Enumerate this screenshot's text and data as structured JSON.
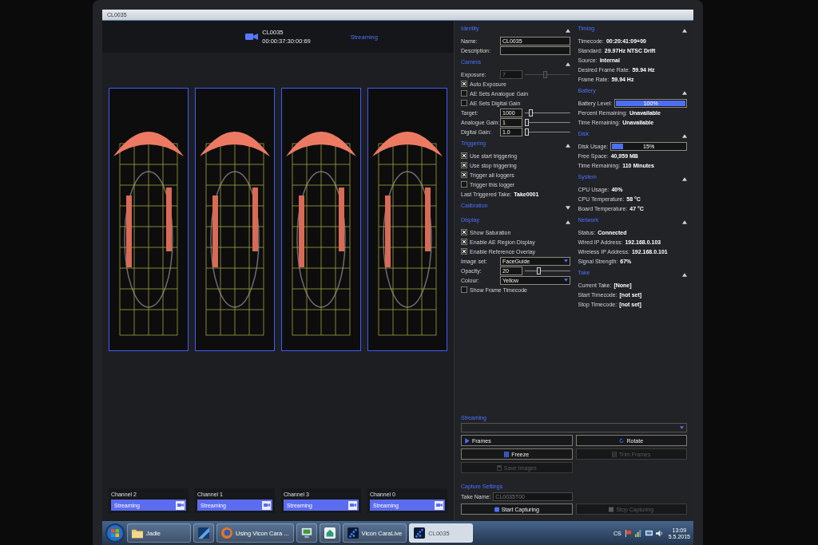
{
  "window": {
    "title": "CL0035"
  },
  "header": {
    "camera_name": "CL0035",
    "timecode": "00:00:37:30:00:69",
    "status": "Streaming"
  },
  "channels": [
    {
      "label": "Channel 2",
      "status": "Streaming"
    },
    {
      "label": "Channel 1",
      "status": "Streaming"
    },
    {
      "label": "Channel 3",
      "status": "Streaming"
    },
    {
      "label": "Channel 0",
      "status": "Streaming"
    }
  ],
  "settings_left": [
    {
      "title": "Identity",
      "expanded": true,
      "rows": [
        {
          "kind": "field",
          "label": "Name:",
          "value": "CL0035"
        },
        {
          "kind": "field",
          "label": "Description:"
        }
      ]
    },
    {
      "title": "Camera",
      "expanded": true,
      "rows": [
        {
          "kind": "slider",
          "label": "Exposure:",
          "value": "7",
          "level": 0.45,
          "disabled": true
        },
        {
          "kind": "checkbox",
          "label": "Auto Exposure",
          "checked": true
        },
        {
          "kind": "checkbox",
          "label": "AE Sets Analogue Gain",
          "checked": false
        },
        {
          "kind": "checkbox",
          "label": "AE Sets Digital Gain",
          "checked": false
        },
        {
          "kind": "slider",
          "label": "Target:",
          "value": "1000",
          "level": 0.1,
          "disabled": false
        },
        {
          "kind": "slider",
          "label": "Analogue Gain:",
          "value": "1",
          "level": 0,
          "disabled": false
        },
        {
          "kind": "slider",
          "label": "Digital Gain:",
          "value": "1.0",
          "level": 0,
          "disabled": false
        }
      ]
    },
    {
      "title": "Triggering",
      "expanded": true,
      "rows": [
        {
          "kind": "checkbox",
          "label": "Use start triggering",
          "checked": true
        },
        {
          "kind": "checkbox",
          "label": "Use stop triggering",
          "checked": true
        },
        {
          "kind": "checkbox",
          "label": "Trigger all loggers",
          "checked": true
        },
        {
          "kind": "checkbox",
          "label": "Trigger this logger",
          "checked": false
        },
        {
          "kind": "info",
          "label": "Last Triggered Take:",
          "value": "Take0001"
        }
      ]
    },
    {
      "title": "Calibration",
      "expanded": false
    },
    {
      "title": "Display",
      "expanded": true,
      "rows": [
        {
          "kind": "checkbox",
          "label": "Show Saturation",
          "checked": true
        },
        {
          "kind": "checkbox",
          "label": "Enable AE Region Display",
          "checked": true
        },
        {
          "kind": "checkbox",
          "label": "Enable Reference Overlay",
          "checked": true
        },
        {
          "kind": "dropdown",
          "label": "Image set:",
          "value": "FaceGuide"
        },
        {
          "kind": "slider",
          "label": "Opacity:",
          "value": "20",
          "level": 0.3,
          "disabled": false
        },
        {
          "kind": "dropdown",
          "label": "Colour:",
          "value": "Yellow"
        },
        {
          "kind": "checkbox",
          "label": "Show Frame Timecode",
          "checked": false
        }
      ]
    }
  ],
  "settings_right": [
    {
      "title": "Timing",
      "expanded": true,
      "rows": [
        {
          "kind": "info",
          "label": "Timecode:",
          "value": "00:20:41:09+00"
        },
        {
          "kind": "info",
          "label": "Standard:",
          "value": "29.97Hz NTSC Drift"
        },
        {
          "kind": "info",
          "label": "Source:",
          "value": "Internal"
        },
        {
          "kind": "info",
          "label": "Desired Frame Rate:",
          "value": "59.94 Hz"
        },
        {
          "kind": "info",
          "label": "Frame Rate:",
          "value": "59.94 Hz"
        }
      ]
    },
    {
      "title": "Battery",
      "expanded": true,
      "rows": [
        {
          "kind": "meter",
          "label": "Battery Level:",
          "reading": "100%",
          "level": 1
        },
        {
          "kind": "info",
          "label": "Percent Remaining:",
          "value": "Unavailable"
        },
        {
          "kind": "info",
          "label": "Time Remaining:",
          "value": "Unavailable"
        }
      ]
    },
    {
      "title": "Disk",
      "expanded": true,
      "rows": [
        {
          "kind": "meter",
          "label": "Disk Usage:",
          "reading": "15%",
          "level": 0.15
        },
        {
          "kind": "info",
          "label": "Free Space:",
          "value": "40,959 MB"
        },
        {
          "kind": "info",
          "label": "Time Remaining:",
          "value": "110 Minutes"
        }
      ]
    },
    {
      "title": "System",
      "expanded": true,
      "rows": [
        {
          "kind": "info",
          "label": "CPU Usage:",
          "value": "40%"
        },
        {
          "kind": "info",
          "label": "CPU Temperature:",
          "value": "58 °C"
        },
        {
          "kind": "info",
          "label": "Board Temperature:",
          "value": "47 °C"
        }
      ]
    },
    {
      "title": "Network",
      "expanded": true,
      "rows": [
        {
          "kind": "info",
          "label": "Status:",
          "value": "Connected"
        },
        {
          "kind": "info",
          "label": "Wired IP Address:",
          "value": "192.168.0.103"
        },
        {
          "kind": "info",
          "label": "Wireless IP Address:",
          "value": "192.168.0.101"
        },
        {
          "kind": "info",
          "label": "Signal Strength:",
          "value": "67%"
        }
      ]
    },
    {
      "title": "Take",
      "expanded": true,
      "rows": [
        {
          "kind": "info",
          "label": "Current Take:",
          "value": "[None]"
        },
        {
          "kind": "info",
          "label": "Start Timecode:",
          "value": "[not set]"
        },
        {
          "kind": "info",
          "label": "Stop Timecode:",
          "value": "[not set]"
        }
      ]
    }
  ],
  "streaming": {
    "title": "Streaming",
    "buttons": [
      {
        "kind": "frames",
        "label": "Frames",
        "disabled": false
      },
      {
        "kind": "rotate",
        "label": "Rotate",
        "disabled": false
      },
      {
        "kind": "freeze",
        "label": "Freeze",
        "disabled": false
      },
      {
        "kind": "trim",
        "label": "Trim Frames",
        "disabled": true
      },
      {
        "kind": "save",
        "label": "Save Images",
        "disabled": true
      }
    ]
  },
  "capture": {
    "title": "Capture Settings",
    "take_name": {
      "label": "Take Name:",
      "value": "CL0035T00",
      "disabled": true
    },
    "buttons": [
      {
        "kind": "start",
        "label": "Start Capturing",
        "disabled": false
      },
      {
        "kind": "stop",
        "label": "Stop Capturing",
        "disabled": true
      }
    ]
  },
  "taskbar": {
    "items": [
      {
        "kind": "folder",
        "label": "Jadle",
        "selected": false
      },
      {
        "kind": "media",
        "selected": false
      },
      {
        "kind": "browser",
        "label": "Using Vicon Cara ...",
        "selected": false
      },
      {
        "kind": "monitor",
        "selected": false
      },
      {
        "kind": "app",
        "selected": false
      },
      {
        "kind": "vicon",
        "label": "Vicon CaraLive",
        "selected": false
      },
      {
        "kind": "vicon",
        "label": "CL0035",
        "selected": true
      }
    ],
    "tray": {
      "language": "CS",
      "time": "13:09",
      "date": "5.5.2015"
    }
  }
}
